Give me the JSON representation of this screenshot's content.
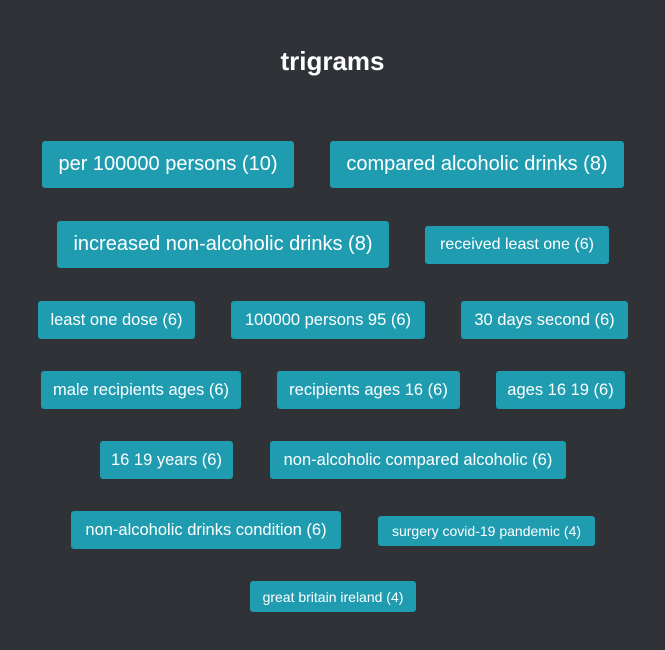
{
  "page": {
    "title": "trigrams"
  },
  "tags": [
    {
      "label": "per 100000 persons (10)"
    },
    {
      "label": "compared alcoholic drinks (8)"
    },
    {
      "label": "increased non-alcoholic drinks (8)"
    },
    {
      "label": "received least one (6)"
    },
    {
      "label": "least one dose (6)"
    },
    {
      "label": "100000 persons 95 (6)"
    },
    {
      "label": "30 days second (6)"
    },
    {
      "label": "male recipients ages (6)"
    },
    {
      "label": "recipients ages 16 (6)"
    },
    {
      "label": "ages 16 19 (6)"
    },
    {
      "label": "16 19 years (6)"
    },
    {
      "label": "non-alcoholic compared alcoholic (6)"
    },
    {
      "label": "non-alcoholic drinks condition (6)"
    },
    {
      "label": "surgery covid-19 pandemic (4)"
    },
    {
      "label": "great britain ireland (4)"
    }
  ],
  "colors": {
    "background": "#2f3337",
    "tag": "#1f9cb0",
    "text": "#ffffff"
  }
}
